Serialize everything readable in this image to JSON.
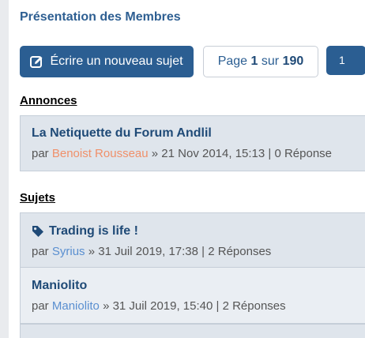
{
  "forum": {
    "title": "Présentation des Membres"
  },
  "toolbar": {
    "new_topic_label": "Écrire un nouveau sujet",
    "page_prefix": "Page",
    "current_page": "1",
    "page_sep": "sur",
    "total_pages": "190",
    "page_button": "1"
  },
  "announcements": {
    "heading": "Annonces",
    "items": [
      {
        "title": "La Netiquette du Forum Andlil",
        "by": "par",
        "author": "Benoist Rousseau",
        "author_color": "#f0906a",
        "info": "» 21 Nov 2014, 15:13 | 0 Réponse"
      }
    ]
  },
  "topics": {
    "heading": "Sujets",
    "items": [
      {
        "icon": "tag-icon",
        "title": "Trading is life !",
        "by": "par",
        "author": "Syrius",
        "author_color": "#5a8fd0",
        "info": "» 31 Juil 2019, 17:38 | 2 Réponses"
      },
      {
        "title": "Maniolito",
        "by": "par",
        "author": "Maniolito",
        "author_color": "#5a8fd0",
        "info": "» 31 Juil 2019, 15:40 | 2 Réponses"
      }
    ]
  }
}
